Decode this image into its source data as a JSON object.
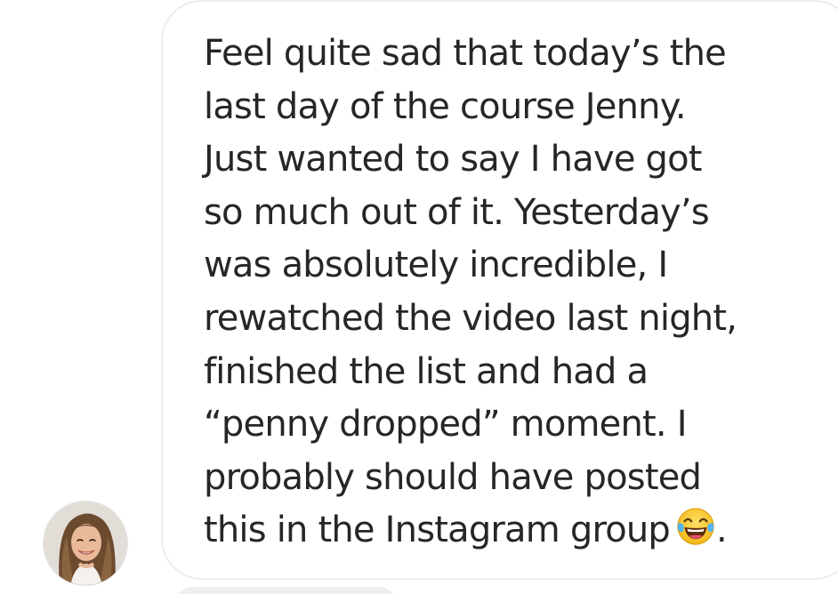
{
  "message": {
    "lines": [
      "Feel quite sad that today’s the",
      "last day of the course Jenny.",
      "Just wanted to say I have got",
      "so much out of it. Yesterday’s",
      "was absolutely incredible, I",
      "rewatched the video last night,",
      "finished the list and had a",
      "“penny dropped” moment. I",
      "probably should have posted",
      "this in the Instagram group"
    ],
    "trailing_punctuation": ".",
    "emoji_icon": "face-with-tears-of-joy-icon"
  },
  "sender": {
    "avatar_icon": "avatar"
  },
  "colors": {
    "text": "#262626",
    "bubble_border": "#ececec",
    "background": "#ffffff"
  }
}
